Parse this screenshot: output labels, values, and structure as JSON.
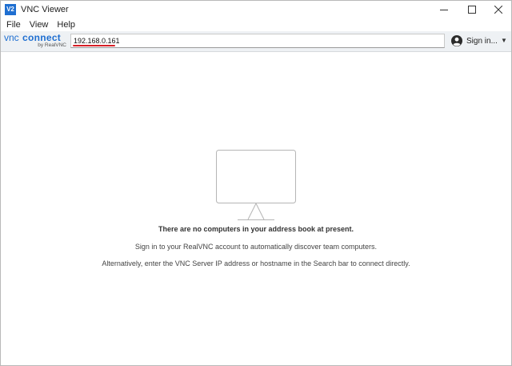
{
  "window": {
    "title": "VNC Viewer",
    "app_icon_text": "V2",
    "controls": {
      "minimize": "—",
      "maximize": "☐",
      "close": "✕"
    }
  },
  "menu": {
    "items": [
      "File",
      "View",
      "Help"
    ]
  },
  "toolbar": {
    "logo_main": "vnc connect",
    "logo_sub": "by RealVNC",
    "search_value": "192.168.0.161",
    "signin_label": "Sign in...",
    "signin_caret": "▼"
  },
  "content": {
    "empty_icon": "monitor-icon",
    "message_title": "There are no computers in your address book at present.",
    "message_signin": "Sign in to your RealVNC account to automatically discover team computers.",
    "message_alt": "Alternatively, enter the VNC Server IP address or hostname in the Search bar to connect directly."
  },
  "colors": {
    "brand": "#1f6fd1",
    "highlight": "#d61f26",
    "toolbar_bg": "#eef1f4"
  }
}
